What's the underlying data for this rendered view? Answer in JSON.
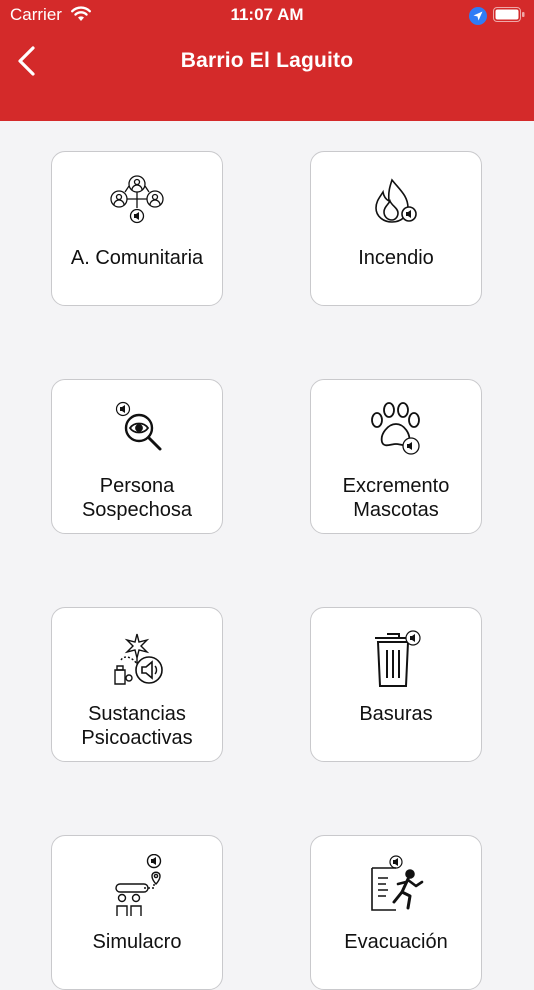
{
  "status_bar": {
    "carrier": "Carrier",
    "time": "11:07 AM"
  },
  "header": {
    "title": "Barrio El Laguito",
    "back_icon": "chevron-left-icon"
  },
  "colors": {
    "header": "#d42a2a",
    "background": "#f4f4f6",
    "card_border": "#c9c9cc"
  },
  "cards": [
    {
      "label_1": "A. Comunitaria",
      "icon": "community-alarm-icon"
    },
    {
      "label_1": "Incendio",
      "icon": "fire-icon"
    },
    {
      "label_1": "Persona",
      "label_2": "Sospechosa",
      "icon": "suspicious-person-icon"
    },
    {
      "label_1": "Excremento",
      "label_2": "Mascotas",
      "icon": "paw-icon"
    },
    {
      "label_1": "Sustancias",
      "label_2": "Psicoactivas",
      "icon": "psychoactive-substances-icon"
    },
    {
      "label_1": "Basuras",
      "icon": "trash-icon"
    },
    {
      "label_1": "Simulacro",
      "icon": "drill-icon"
    },
    {
      "label_1": "Evacuación",
      "icon": "evacuation-icon"
    }
  ]
}
